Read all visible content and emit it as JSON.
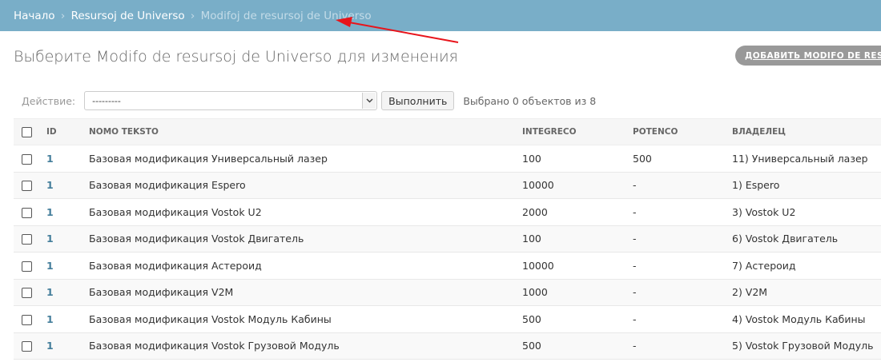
{
  "breadcrumbs": {
    "home": "Начало",
    "section": "Resursoj de Universo",
    "current": "Modifoj de resursoj de Universo",
    "separator": "›"
  },
  "page_title": "Выберите Modifo de resursoj de Universo для изменения",
  "add_button": "ДОБАВИТЬ MODIFO DE RESURSOJ DE UNIVERSO",
  "actions": {
    "label": "Действие:",
    "select_value": "---------",
    "run_button": "Выполнить",
    "counter": "Выбрано 0 объектов из 8"
  },
  "table": {
    "headers": [
      "ID",
      "NOMO TEKSTO",
      "INTEGRECO",
      "POTENCO",
      "ВЛАДЕЛЕЦ"
    ],
    "rows": [
      {
        "id": "1",
        "name": "Базовая модификация Универсальный лазер",
        "integreco": "100",
        "potenco": "500",
        "owner": "11) Универсальный лазер"
      },
      {
        "id": "1",
        "name": "Базовая модификация Espero",
        "integreco": "10000",
        "potenco": "-",
        "owner": "1) Espero"
      },
      {
        "id": "1",
        "name": "Базовая модификация Vostok U2",
        "integreco": "2000",
        "potenco": "-",
        "owner": "3) Vostok U2"
      },
      {
        "id": "1",
        "name": "Базовая модификация Vostok Двигатель",
        "integreco": "100",
        "potenco": "-",
        "owner": "6) Vostok Двигатель"
      },
      {
        "id": "1",
        "name": "Базовая модификация Астероид",
        "integreco": "10000",
        "potenco": "-",
        "owner": "7) Астероид"
      },
      {
        "id": "1",
        "name": "Базовая модификация V2M",
        "integreco": "1000",
        "potenco": "-",
        "owner": "2) V2M"
      },
      {
        "id": "1",
        "name": "Базовая модификация Vostok Модуль Кабины",
        "integreco": "500",
        "potenco": "-",
        "owner": "4) Vostok Модуль Кабины"
      },
      {
        "id": "1",
        "name": "Базовая модификация Vostok Грузовой Модуль",
        "integreco": "500",
        "potenco": "-",
        "owner": "5) Vostok Грузовой Модуль"
      }
    ]
  },
  "colors": {
    "header_bar": "#79aec8",
    "link": "#447e9b",
    "annotation_arrow": "#e8141b"
  }
}
